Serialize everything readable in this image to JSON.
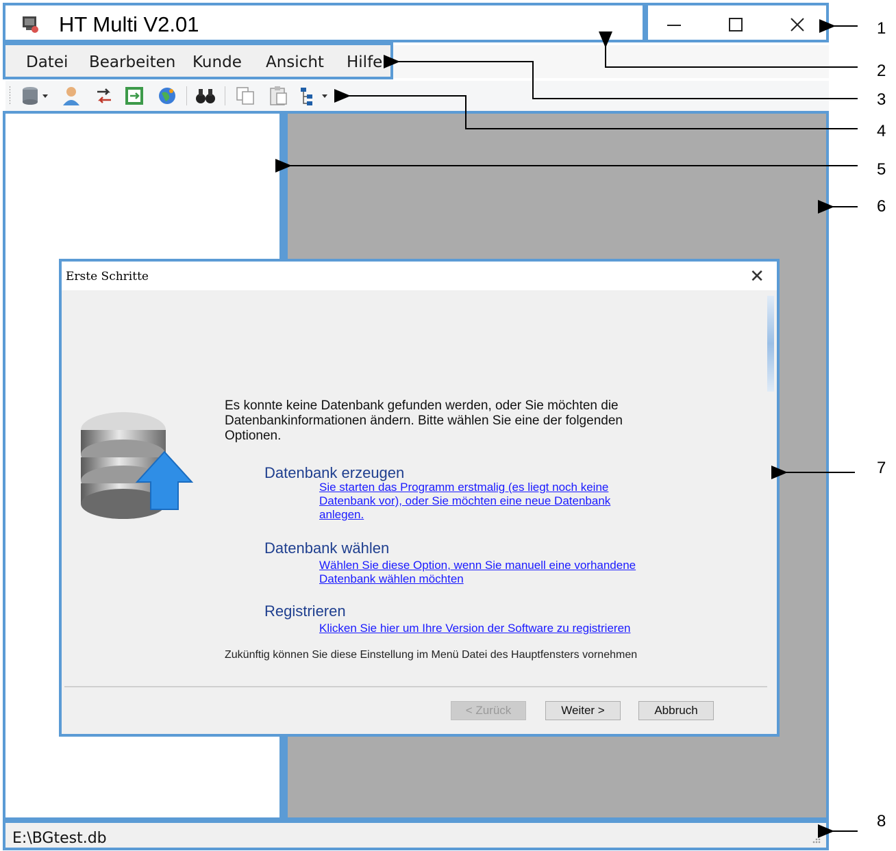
{
  "app": {
    "title": "HT Multi V2.01",
    "window_controls": {
      "minimize": "—",
      "maximize": "☐",
      "close": "✕"
    }
  },
  "menu": {
    "items": [
      "Datei",
      "Bearbeiten",
      "Kunde",
      "Ansicht",
      "Hilfe"
    ]
  },
  "toolbar": {
    "icons": [
      "database-dropdown-icon",
      "user-icon",
      "import-icon",
      "export-icon",
      "globe-icon",
      "binoculars-icon",
      "copy-icon",
      "paste-icon",
      "tree-dropdown-icon"
    ]
  },
  "dialog": {
    "title": "Erste Schritte",
    "close": "✕",
    "intro": "Es konnte keine Datenbank gefunden werden, oder Sie möchten die Datenbankinformationen ändern. Bitte wählen Sie eine der folgenden Optionen.",
    "options": [
      {
        "heading": "Datenbank erzeugen",
        "link": "Sie starten das Programm erstmalig (es liegt noch keine Datenbank vor), oder Sie möchten eine neue Datenbank anlegen."
      },
      {
        "heading": "Datenbank wählen",
        "link": "Wählen Sie diese Option, wenn Sie manuell eine vorhandene Datenbank wählen möchten"
      },
      {
        "heading": "Registrieren",
        "link": "Klicken Sie hier um Ihre Version der Software zu registrieren"
      }
    ],
    "hint": "Zukünftig können Sie diese Einstellung im Menü Datei des Hauptfensters vornehmen",
    "buttons": {
      "back": "< Zurück",
      "next": "Weiter >",
      "cancel": "Abbruch"
    }
  },
  "status": {
    "path": "E:\\BGtest.db"
  },
  "callouts": [
    "1",
    "2",
    "3",
    "4",
    "5",
    "6",
    "7",
    "8"
  ],
  "colors": {
    "highlight": "#5b9bd5",
    "workspace": "#ababab",
    "link": "#1a1aff",
    "heading": "#1f3f8f"
  }
}
